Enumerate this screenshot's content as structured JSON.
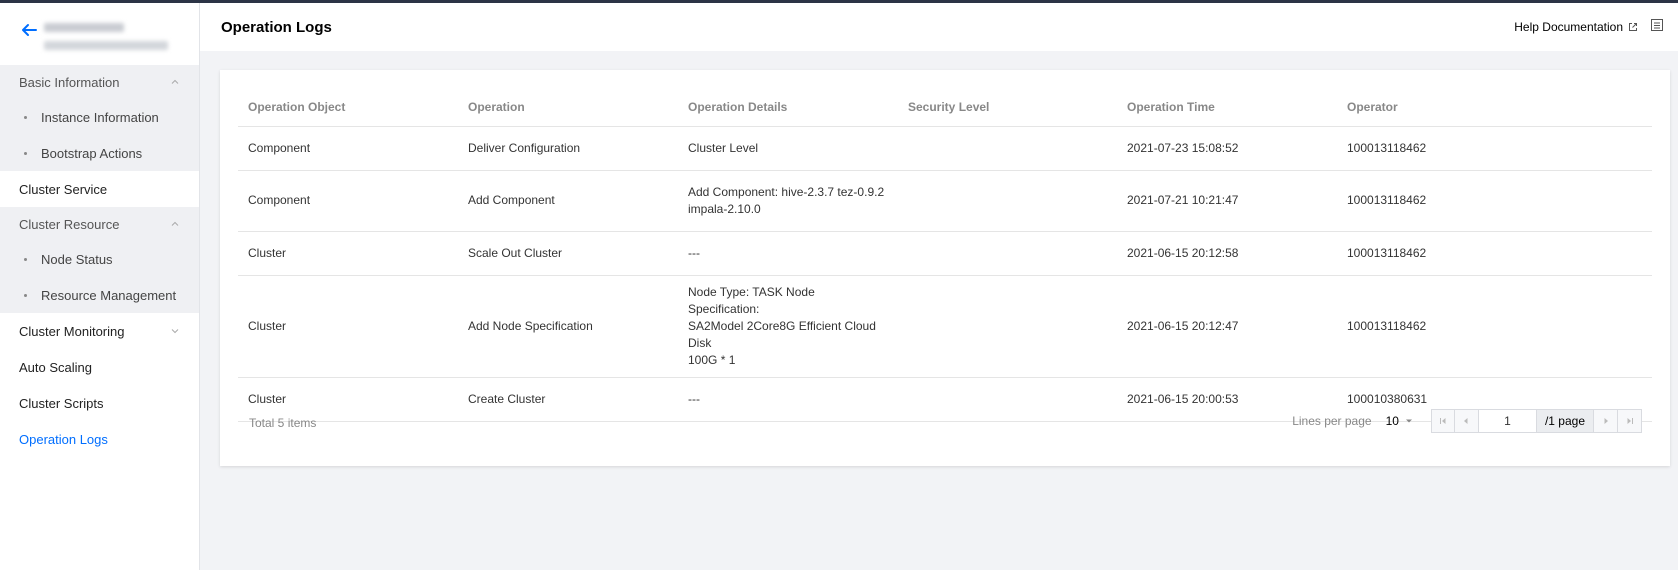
{
  "sidebar": {
    "groups": [
      {
        "label": "Basic Information",
        "items": [
          "Instance Information",
          "Bootstrap Actions"
        ]
      }
    ],
    "cluster_service": "Cluster Service",
    "resource_group": {
      "label": "Cluster Resource",
      "items": [
        "Node Status",
        "Resource Management"
      ]
    },
    "cluster_monitoring": "Cluster Monitoring",
    "auto_scaling": "Auto Scaling",
    "cluster_scripts": "Cluster Scripts",
    "operation_logs": "Operation Logs"
  },
  "header": {
    "title": "Operation Logs",
    "help": "Help Documentation"
  },
  "table": {
    "columns": [
      "Operation Object",
      "Operation",
      "Operation Details",
      "Security Level",
      "Operation Time",
      "Operator"
    ],
    "rows": [
      {
        "object": "Component",
        "operation": "Deliver Configuration",
        "details": [
          "Cluster Level"
        ],
        "security": "",
        "time": "2021-07-23 15:08:52",
        "operator": "100013118462"
      },
      {
        "object": "Component",
        "operation": "Add Component",
        "details": [
          "Add Component: hive-2.3.7 tez-0.9.2",
          "impala-2.10.0"
        ],
        "security": "",
        "time": "2021-07-21 10:21:47",
        "operator": "100013118462"
      },
      {
        "object": "Cluster",
        "operation": "Scale Out Cluster",
        "details": [
          "---"
        ],
        "security": "",
        "time": "2021-06-15 20:12:58",
        "operator": "100013118462"
      },
      {
        "object": "Cluster",
        "operation": "Add Node Specification",
        "details": [
          "Node Type: TASK Node Specification:",
          "SA2Model 2Core8G Efficient Cloud Disk",
          "100G * 1"
        ],
        "security": "",
        "time": "2021-06-15 20:12:47",
        "operator": "100013118462"
      },
      {
        "object": "Cluster",
        "operation": "Create Cluster",
        "details": [
          "---"
        ],
        "security": "",
        "time": "2021-06-15 20:00:53",
        "operator": "100010380631"
      }
    ]
  },
  "footer": {
    "total": "Total 5 items",
    "lines_label": "Lines per page",
    "lines_value": "10",
    "page_value": "1",
    "page_of": "/1 page"
  },
  "colors": {
    "accent": "#006eff",
    "topbar": "#2c3446"
  }
}
